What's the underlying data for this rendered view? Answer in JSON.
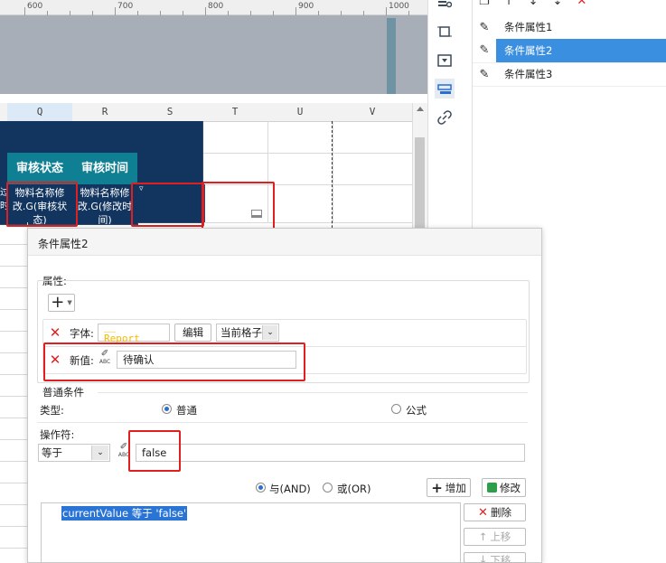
{
  "ruler": {
    "ticks": [
      "600",
      "700",
      "800",
      "900",
      "1000"
    ]
  },
  "columns": [
    "Q",
    "R",
    "S",
    "T",
    "U",
    "V"
  ],
  "cells": {
    "q_header": "审核状态",
    "r_header": "审核时间",
    "q_data": "物料名称修改.G(审核状态)",
    "r_data": "物料名称修改.G(修改时间)",
    "left_fragment_1": "过",
    "left_fragment_2": "时",
    "s_marker": "▿"
  },
  "conditions": {
    "items": [
      {
        "label": "条件属性1"
      },
      {
        "label": "条件属性2"
      },
      {
        "label": "条件属性3"
      }
    ]
  },
  "dialog": {
    "title": "条件属性2",
    "attributes_label": "属性:",
    "add_glyph": "+",
    "font_label": "字体:",
    "font_preview": "__ Report__",
    "edit_label": "编辑",
    "scope_value": "当前格子",
    "new_value_label": "新值:",
    "new_value": "待确认",
    "general_condition_label": "普通条件",
    "type_label": "类型:",
    "type_normal": "普通",
    "type_formula": "公式",
    "operator_label": "操作符:",
    "operator_value": "等于",
    "operand_value": "false",
    "and_label": "与(AND)",
    "or_label": "或(OR)",
    "add_button": "增加",
    "modify_button": "修改",
    "delete_button": "删除",
    "up_button": "上移",
    "down_button": "下移",
    "expression": "currentValue 等于 'false'",
    "abc_glyph": "ABC"
  },
  "colors": {
    "navy": "#12355f",
    "teal": "#0f7f93",
    "header_text": "#ffffff",
    "selection": "#3b8fe0",
    "highlight": "#e02020"
  }
}
